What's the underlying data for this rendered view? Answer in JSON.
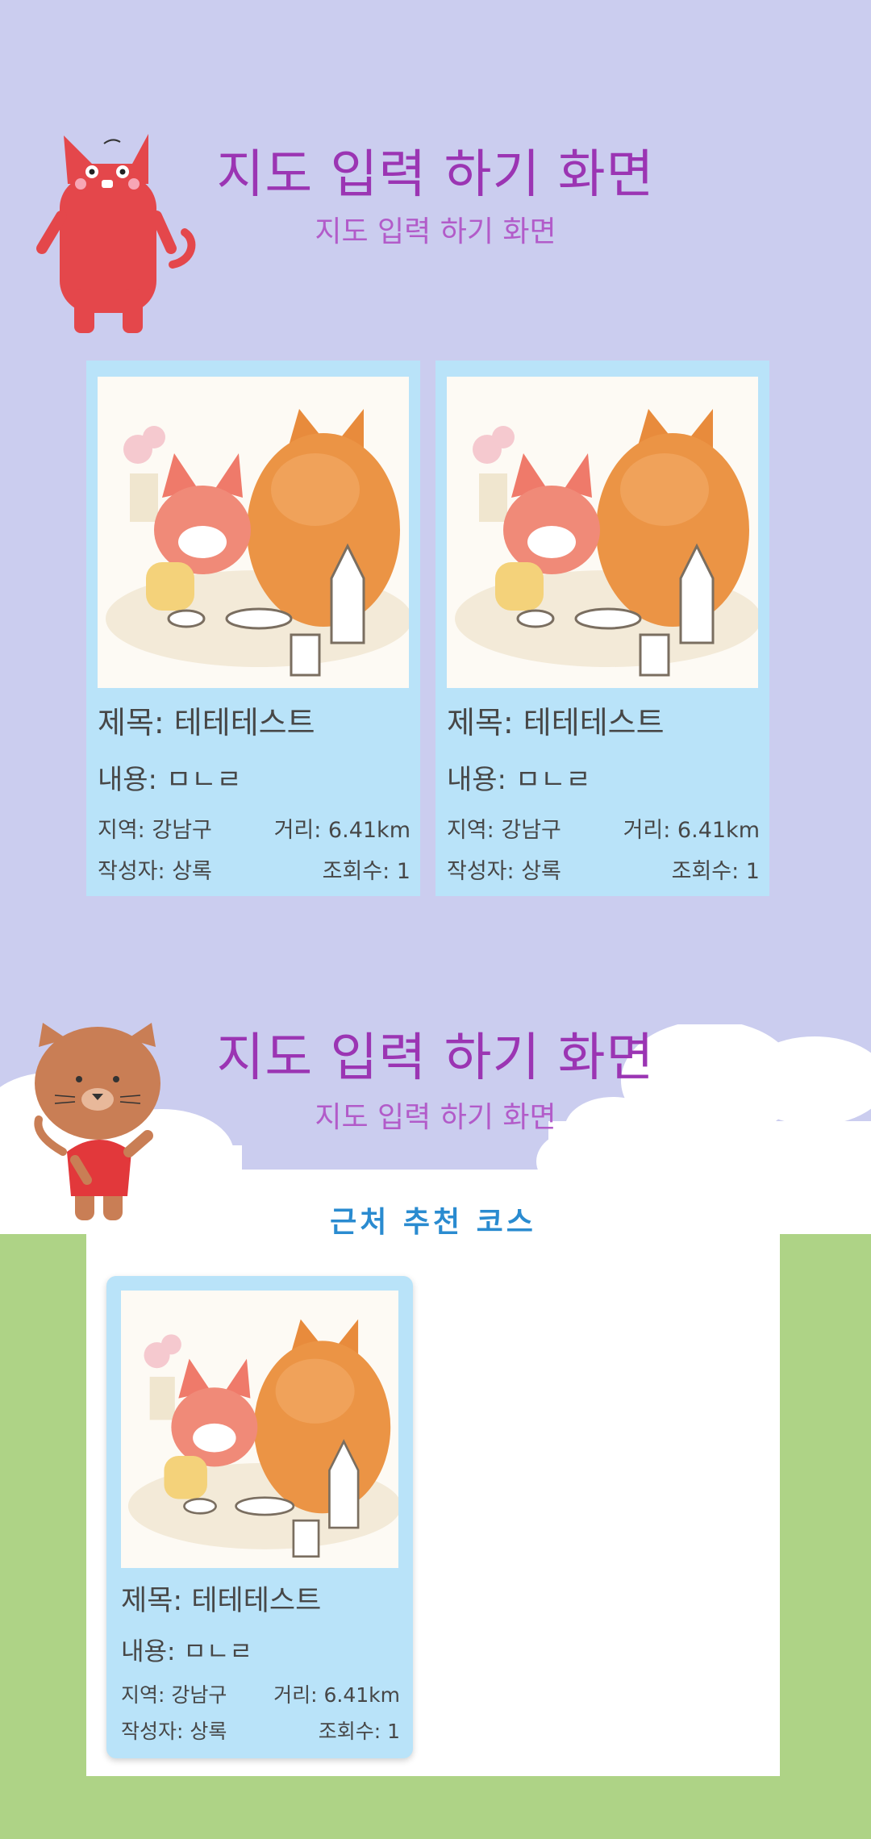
{
  "header_top": {
    "title": "지도 입력 하기 화면",
    "subtitle": "지도 입력 하기 화면"
  },
  "header_bottom": {
    "title": "지도 입력 하기 화면",
    "subtitle": "지도 입력 하기 화면"
  },
  "top_cards": [
    {
      "title": "제목: 테테테스트",
      "content": "내용: ㅁㄴㄹ",
      "region": "지역: 강남구",
      "distance": "거리: 6.41km",
      "author": "작성자: 상록",
      "views": "조회수: 1"
    },
    {
      "title": "제목: 테테테스트",
      "content": "내용: ㅁㄴㄹ",
      "region": "지역: 강남구",
      "distance": "거리: 6.41km",
      "author": "작성자: 상록",
      "views": "조회수: 1"
    }
  ],
  "recommend": {
    "heading": "근처 추천 코스",
    "cards": [
      {
        "title": "제목: 테테테스트",
        "content": "내용: ㅁㄴㄹ",
        "region": "지역: 강남구",
        "distance": "거리: 6.41km",
        "author": "작성자: 상록",
        "views": "조회수: 1"
      }
    ]
  },
  "colors": {
    "background": "#cbcdef",
    "title": "#9b35b3",
    "card": "#b9e3f9",
    "grass": "#aed386",
    "accent": "#2a8bd0"
  },
  "icons": [
    "red-cat-mascot-icon",
    "brown-cat-mascot-icon",
    "fox-illustration-icon"
  ]
}
